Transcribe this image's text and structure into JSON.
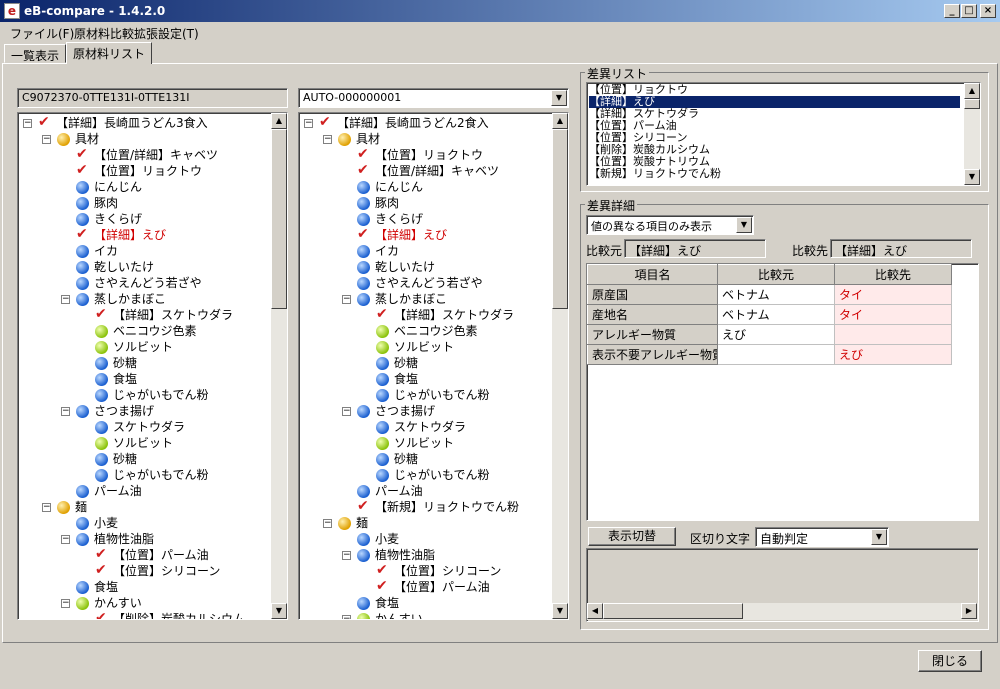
{
  "window": {
    "title": "eB-compare - 1.4.2.0",
    "icon": "e"
  },
  "menu": [
    "ファイル(F)",
    "原材料比較拡張設定(T)"
  ],
  "tabs": [
    "一覧表示",
    "原材料リスト"
  ],
  "left": {
    "id": "C9072370-0TTE131I-0TTE131I",
    "tree": [
      {
        "d": 0,
        "exp": "-",
        "icon": "check",
        "label": "【詳細】長崎皿うどん3食入"
      },
      {
        "d": 1,
        "exp": "-",
        "icon": "orange",
        "label": "具材"
      },
      {
        "d": 2,
        "icon": "check",
        "label": "【位置/詳細】キャベツ"
      },
      {
        "d": 2,
        "icon": "check",
        "label": "【位置】リョクトウ"
      },
      {
        "d": 2,
        "icon": "blue",
        "label": "にんじん"
      },
      {
        "d": 2,
        "icon": "blue",
        "label": "豚肉"
      },
      {
        "d": 2,
        "icon": "blue",
        "label": "きくらげ"
      },
      {
        "d": 2,
        "icon": "check",
        "label": "【詳細】えび",
        "red": true
      },
      {
        "d": 2,
        "icon": "blue",
        "label": "イカ"
      },
      {
        "d": 2,
        "icon": "blue",
        "label": "乾しいたけ"
      },
      {
        "d": 2,
        "icon": "blue",
        "label": "さやえんどう若ざや"
      },
      {
        "d": 2,
        "exp": "-",
        "icon": "blue",
        "label": "蒸しかまぼこ"
      },
      {
        "d": 3,
        "icon": "check",
        "label": "【詳細】スケトウダラ"
      },
      {
        "d": 3,
        "icon": "green",
        "label": "ベニコウジ色素"
      },
      {
        "d": 3,
        "icon": "green",
        "label": "ソルビット"
      },
      {
        "d": 3,
        "icon": "blue",
        "label": "砂糖"
      },
      {
        "d": 3,
        "icon": "blue",
        "label": "食塩"
      },
      {
        "d": 3,
        "icon": "blue",
        "label": "じゃがいもでん粉"
      },
      {
        "d": 2,
        "exp": "-",
        "icon": "blue",
        "label": "さつま揚げ"
      },
      {
        "d": 3,
        "icon": "blue",
        "label": "スケトウダラ"
      },
      {
        "d": 3,
        "icon": "green",
        "label": "ソルビット"
      },
      {
        "d": 3,
        "icon": "blue",
        "label": "砂糖"
      },
      {
        "d": 3,
        "icon": "blue",
        "label": "じゃがいもでん粉"
      },
      {
        "d": 2,
        "icon": "blue",
        "label": "パーム油"
      },
      {
        "d": 1,
        "exp": "-",
        "icon": "orange",
        "label": "麺"
      },
      {
        "d": 2,
        "icon": "blue",
        "label": "小麦"
      },
      {
        "d": 2,
        "exp": "-",
        "icon": "blue",
        "label": "植物性油脂"
      },
      {
        "d": 3,
        "icon": "check",
        "label": "【位置】パーム油"
      },
      {
        "d": 3,
        "icon": "check",
        "label": "【位置】シリコーン"
      },
      {
        "d": 2,
        "icon": "blue",
        "label": "食塩"
      },
      {
        "d": 2,
        "exp": "-",
        "icon": "green",
        "label": "かんすい"
      },
      {
        "d": 3,
        "icon": "check",
        "label": "【削除】炭酸カルシウム"
      }
    ]
  },
  "right": {
    "combo": "AUTO-000000001",
    "tree": [
      {
        "d": 0,
        "exp": "-",
        "icon": "check",
        "label": "【詳細】長崎皿うどん2食入"
      },
      {
        "d": 1,
        "exp": "-",
        "icon": "orange",
        "label": "具材"
      },
      {
        "d": 2,
        "icon": "check",
        "label": "【位置】リョクトウ"
      },
      {
        "d": 2,
        "icon": "check",
        "label": "【位置/詳細】キャベツ"
      },
      {
        "d": 2,
        "icon": "blue",
        "label": "にんじん"
      },
      {
        "d": 2,
        "icon": "blue",
        "label": "豚肉"
      },
      {
        "d": 2,
        "icon": "blue",
        "label": "きくらげ"
      },
      {
        "d": 2,
        "icon": "check",
        "label": "【詳細】えび",
        "red": true
      },
      {
        "d": 2,
        "icon": "blue",
        "label": "イカ"
      },
      {
        "d": 2,
        "icon": "blue",
        "label": "乾しいたけ"
      },
      {
        "d": 2,
        "icon": "blue",
        "label": "さやえんどう若ざや"
      },
      {
        "d": 2,
        "exp": "-",
        "icon": "blue",
        "label": "蒸しかまぼこ"
      },
      {
        "d": 3,
        "icon": "check",
        "label": "【詳細】スケトウダラ"
      },
      {
        "d": 3,
        "icon": "green",
        "label": "ベニコウジ色素"
      },
      {
        "d": 3,
        "icon": "green",
        "label": "ソルビット"
      },
      {
        "d": 3,
        "icon": "blue",
        "label": "砂糖"
      },
      {
        "d": 3,
        "icon": "blue",
        "label": "食塩"
      },
      {
        "d": 3,
        "icon": "blue",
        "label": "じゃがいもでん粉"
      },
      {
        "d": 2,
        "exp": "-",
        "icon": "blue",
        "label": "さつま揚げ"
      },
      {
        "d": 3,
        "icon": "blue",
        "label": "スケトウダラ"
      },
      {
        "d": 3,
        "icon": "green",
        "label": "ソルビット"
      },
      {
        "d": 3,
        "icon": "blue",
        "label": "砂糖"
      },
      {
        "d": 3,
        "icon": "blue",
        "label": "じゃがいもでん粉"
      },
      {
        "d": 2,
        "icon": "blue",
        "label": "パーム油"
      },
      {
        "d": 2,
        "icon": "check",
        "label": "【新規】リョクトウでん粉"
      },
      {
        "d": 1,
        "exp": "-",
        "icon": "orange",
        "label": "麺"
      },
      {
        "d": 2,
        "icon": "blue",
        "label": "小麦"
      },
      {
        "d": 2,
        "exp": "-",
        "icon": "blue",
        "label": "植物性油脂"
      },
      {
        "d": 3,
        "icon": "check",
        "label": "【位置】シリコーン"
      },
      {
        "d": 3,
        "icon": "check",
        "label": "【位置】パーム油"
      },
      {
        "d": 2,
        "icon": "blue",
        "label": "食塩"
      },
      {
        "d": 2,
        "exp": "-",
        "icon": "green",
        "label": "かんすい"
      }
    ]
  },
  "diff_list": {
    "title": "差異リスト",
    "items": [
      "【位置】リョクトウ",
      "【詳細】えび",
      "【詳細】スケトウダラ",
      "【位置】パーム油",
      "【位置】シリコーン",
      "【削除】炭酸カルシウム",
      "【位置】炭酸ナトリウム",
      "【新規】リョクトウでん粉"
    ],
    "selected": 1
  },
  "diff_detail": {
    "title": "差異詳細",
    "filter": "値の異なる項目のみ表示",
    "source_label": "比較元",
    "source_value": "【詳細】えび",
    "target_label": "比較先",
    "target_value": "【詳細】えび",
    "columns": [
      "項目名",
      "比較元",
      "比較先"
    ],
    "rows": [
      {
        "name": "原産国",
        "src": "ベトナム",
        "dst": "タイ"
      },
      {
        "name": "産地名",
        "src": "ベトナム",
        "dst": "タイ"
      },
      {
        "name": "アレルギー物質",
        "src": "えび",
        "dst": ""
      },
      {
        "name": "表示不要アレルギー物質",
        "src": "",
        "dst": "えび"
      }
    ]
  },
  "bottom_bar": {
    "toggle_label": "表示切替",
    "delimiter_label": "区切り文字",
    "delimiter_value": "自動判定"
  },
  "close_button": "閉じる"
}
